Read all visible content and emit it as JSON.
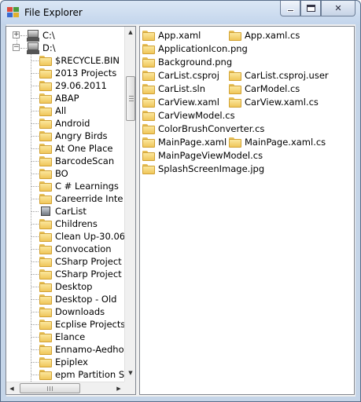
{
  "window": {
    "title": "File Explorer",
    "caption_minimize": "",
    "caption_maximize": "",
    "caption_close": "✕"
  },
  "tree": {
    "drives": [
      {
        "label": "C:\\",
        "expander": "+"
      },
      {
        "label": "D:\\",
        "expander": "−"
      }
    ],
    "items": [
      {
        "label": "$RECYCLE.BIN",
        "icon": "folder-icon"
      },
      {
        "label": "2013 Projects",
        "icon": "folder-icon"
      },
      {
        "label": "29.06.2011",
        "icon": "folder-icon"
      },
      {
        "label": "ABAP",
        "icon": "folder-icon"
      },
      {
        "label": "All",
        "icon": "folder-icon"
      },
      {
        "label": "Android",
        "icon": "folder-icon"
      },
      {
        "label": "Angry Birds",
        "icon": "folder-icon"
      },
      {
        "label": "At One Place",
        "icon": "folder-icon"
      },
      {
        "label": "BarcodeScan",
        "icon": "folder-icon"
      },
      {
        "label": "BO",
        "icon": "folder-icon"
      },
      {
        "label": "C # Learnings",
        "icon": "folder-icon"
      },
      {
        "label": "Careerride Inte",
        "icon": "folder-icon"
      },
      {
        "label": "CarList",
        "icon": "special-folder-icon"
      },
      {
        "label": "Childrens",
        "icon": "folder-icon"
      },
      {
        "label": "Clean Up-30.06",
        "icon": "folder-icon"
      },
      {
        "label": "Convocation",
        "icon": "folder-icon"
      },
      {
        "label": "CSharp Project",
        "icon": "folder-icon"
      },
      {
        "label": "CSharp Project",
        "icon": "folder-icon"
      },
      {
        "label": "Desktop",
        "icon": "folder-icon"
      },
      {
        "label": "Desktop - Old",
        "icon": "folder-icon"
      },
      {
        "label": "Downloads",
        "icon": "folder-icon"
      },
      {
        "label": "Ecplise Projects",
        "icon": "folder-icon"
      },
      {
        "label": "Elance",
        "icon": "folder-icon"
      },
      {
        "label": "Ennamo-Aedho",
        "icon": "folder-icon"
      },
      {
        "label": "Epiplex",
        "icon": "folder-icon"
      },
      {
        "label": "epm Partition S",
        "icon": "folder-icon"
      }
    ],
    "scroll_up": "▲",
    "scroll_down": "▼",
    "scroll_left": "◀",
    "scroll_right": "▶",
    "hthumb_grip": "III"
  },
  "files": {
    "rows": [
      [
        "App.xaml",
        "App.xaml.cs"
      ],
      [
        "ApplicationIcon.png"
      ],
      [
        "Background.png"
      ],
      [
        "CarList.csproj",
        "CarList.csproj.user"
      ],
      [
        "CarList.sln",
        "CarModel.cs"
      ],
      [
        "CarView.xaml",
        "CarView.xaml.cs"
      ],
      [
        "CarViewModel.cs"
      ],
      [
        "ColorBrushConverter.cs"
      ],
      [
        "MainPage.xaml",
        "MainPage.xaml.cs"
      ],
      [
        "MainPageViewModel.cs"
      ],
      [
        "SplashScreenImage.jpg"
      ]
    ]
  }
}
